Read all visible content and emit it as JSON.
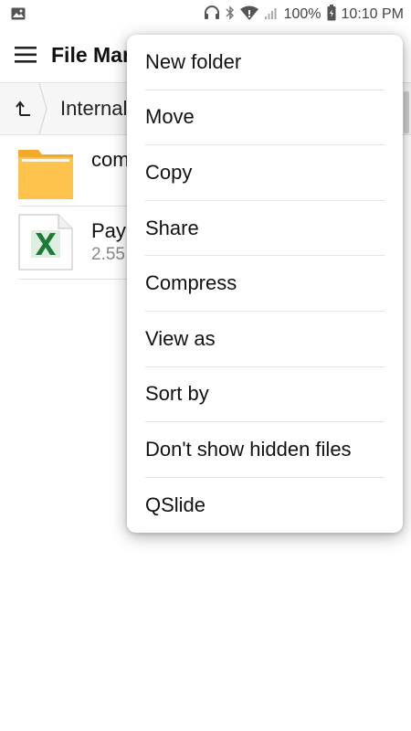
{
  "status_bar": {
    "battery": "100%",
    "time": "10:10 PM",
    "icons": [
      "image-notification-icon",
      "headphones-icon",
      "bluetooth-icon",
      "wifi-icon",
      "signal-icon",
      "battery-icon"
    ]
  },
  "app_bar": {
    "title": "File Manager",
    "menu_icon": "hamburger-menu-icon"
  },
  "breadcrumb": {
    "label": "Internal storage",
    "up_icon": "up-arrow-icon"
  },
  "files": [
    {
      "name": "com",
      "meta": "",
      "icon": "folder-icon"
    },
    {
      "name": "Pay",
      "meta": "2.55",
      "icon": "excel-file-icon"
    }
  ],
  "menu": {
    "items": [
      {
        "label": "New folder"
      },
      {
        "label": "Move"
      },
      {
        "label": "Copy"
      },
      {
        "label": "Share"
      },
      {
        "label": "Compress"
      },
      {
        "label": "View as"
      },
      {
        "label": "Sort by"
      },
      {
        "label": "Don't show hidden files"
      },
      {
        "label": "QSlide"
      }
    ]
  },
  "colors": {
    "folder": "#fbc02d",
    "excel_green": "#1e7b34",
    "menu_bg": "#ffffff"
  }
}
